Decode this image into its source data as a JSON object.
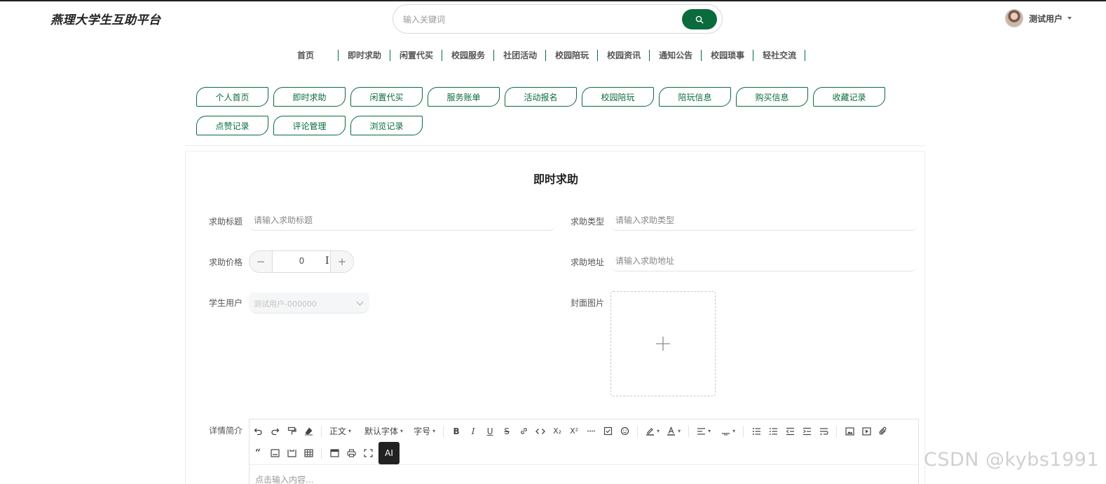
{
  "header": {
    "logo": "燕理大学生互助平台",
    "search_placeholder": "输入关键词",
    "user_name": "测试用户"
  },
  "nav": [
    "首页",
    "即时求助",
    "闲置代买",
    "校园服务",
    "社团活动",
    "校园陪玩",
    "校园资讯",
    "通知公告",
    "校园琐事",
    "轻社交流"
  ],
  "subnav": [
    "个人首页",
    "即时求助",
    "闲置代买",
    "服务账单",
    "活动报名",
    "校园陪玩",
    "陪玩信息",
    "购买信息",
    "收藏记录",
    "点赞记录",
    "评论管理",
    "浏览记录"
  ],
  "form": {
    "title": "即时求助",
    "help_title_label": "求助标题",
    "help_title_placeholder": "请输入求助标题",
    "help_type_label": "求助类型",
    "help_type_placeholder": "请输入求助类型",
    "price_label": "求助价格",
    "price_value": "0",
    "price_minus": "−",
    "price_plus": "+",
    "address_label": "求助地址",
    "address_placeholder": "请输入求助地址",
    "student_label": "学生用户",
    "student_value": "测试用户-000000",
    "cover_label": "封面图片",
    "cover_plus": "+",
    "detail_label": "详情简介",
    "editor_placeholder": "点击输入内容..."
  },
  "toolbar": {
    "paragraph": "正文",
    "font": "默认字体",
    "size": "字号",
    "ai": "AI",
    "bold": "B",
    "italic": "I",
    "underline": "U",
    "strike": "S",
    "sub": "X₂",
    "sup": "X²"
  },
  "watermark": "CSDN @kybs1991",
  "colors": {
    "accent": "#0a6b3c"
  }
}
